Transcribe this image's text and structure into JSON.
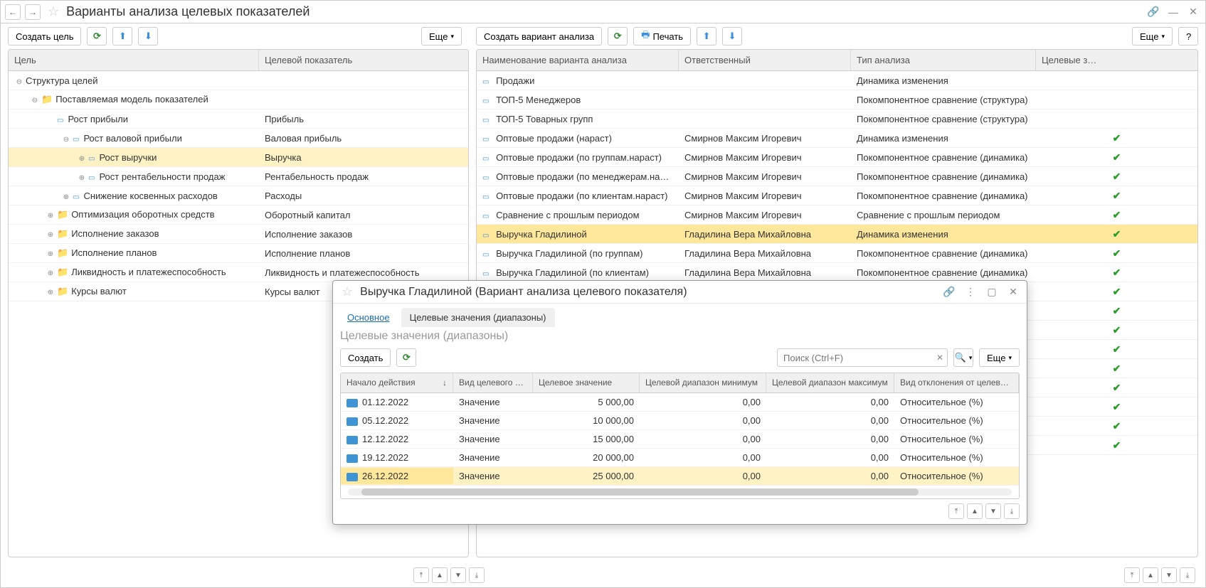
{
  "title": "Варианты анализа целевых показателей",
  "leftToolbar": {
    "createGoal": "Создать цель",
    "more": "Еще"
  },
  "rightToolbar": {
    "createVariant": "Создать вариант анализа",
    "print": "Печать",
    "more": "Еще",
    "help": "?"
  },
  "leftHeaders": {
    "goal": "Цель",
    "indicator": "Целевой показатель"
  },
  "tree": [
    {
      "level": 0,
      "exp": "-",
      "icon": "",
      "label": "Структура целей",
      "indicator": ""
    },
    {
      "level": 1,
      "exp": "-",
      "icon": "folder",
      "label": "Поставляемая модель показателей",
      "indicator": ""
    },
    {
      "level": 2,
      "exp": "",
      "icon": "node",
      "label": "Рост прибыли",
      "indicator": "Прибыль"
    },
    {
      "level": 3,
      "exp": "-",
      "icon": "node",
      "label": "Рост валовой прибыли",
      "indicator": "Валовая прибыль"
    },
    {
      "level": 4,
      "exp": "+",
      "icon": "node",
      "label": "Рост выручки",
      "indicator": "Выручка",
      "sel": true
    },
    {
      "level": 4,
      "exp": "+",
      "icon": "node",
      "label": "Рост рентабельности продаж",
      "indicator": "Рентабельность продаж"
    },
    {
      "level": 3,
      "exp": "+",
      "icon": "node",
      "label": "Снижение косвенных расходов",
      "indicator": "Расходы"
    },
    {
      "level": 2,
      "exp": "+",
      "icon": "folder",
      "label": "Оптимизация оборотных средств",
      "indicator": "Оборотный капитал"
    },
    {
      "level": 2,
      "exp": "+",
      "icon": "folder",
      "label": "Исполнение заказов",
      "indicator": "Исполнение заказов"
    },
    {
      "level": 2,
      "exp": "+",
      "icon": "folder",
      "label": "Исполнение планов",
      "indicator": "Исполнение планов"
    },
    {
      "level": 2,
      "exp": "+",
      "icon": "folder",
      "label": "Ликвидность и платежеспособность",
      "indicator": "Ликвидность и платежеспособность"
    },
    {
      "level": 2,
      "exp": "+",
      "icon": "folder",
      "label": "Курсы валют",
      "indicator": "Курсы валют"
    }
  ],
  "rightHeaders": {
    "name": "Наименование варианта анализа",
    "resp": "Ответственный",
    "type": "Тип анализа",
    "targets": "Целевые з…"
  },
  "variants": [
    {
      "name": "Продажи",
      "resp": "",
      "type": "Динамика изменения",
      "check": false
    },
    {
      "name": "ТОП-5 Менеджеров",
      "resp": "",
      "type": "Покомпонентное сравнение (структура)",
      "check": false
    },
    {
      "name": "ТОП-5 Товарных групп",
      "resp": "",
      "type": "Покомпонентное сравнение (структура)",
      "check": false
    },
    {
      "name": "Оптовые продажи (нараст)",
      "resp": "Смирнов Максим Игоревич",
      "type": "Динамика изменения",
      "check": true
    },
    {
      "name": "Оптовые продажи (по группам.нараст)",
      "resp": "Смирнов Максим Игоревич",
      "type": "Покомпонентное сравнение (динамика)",
      "check": true
    },
    {
      "name": "Оптовые продажи (по менеджерам.нараст)",
      "resp": "Смирнов Максим Игоревич",
      "type": "Покомпонентное сравнение (динамика)",
      "check": true
    },
    {
      "name": "Оптовые продажи (по клиентам.нараст)",
      "resp": "Смирнов Максим Игоревич",
      "type": "Покомпонентное сравнение (динамика)",
      "check": true
    },
    {
      "name": "Сравнение с прошлым периодом",
      "resp": "Смирнов Максим Игоревич",
      "type": "Сравнение с прошлым периодом",
      "check": true
    },
    {
      "name": "Выручка Гладилиной",
      "resp": "Гладилина Вера Михайловна",
      "type": "Динамика изменения",
      "check": true,
      "sel": true
    },
    {
      "name": "Выручка Гладилиной (по группам)",
      "resp": "Гладилина Вера Михайловна",
      "type": "Покомпонентное сравнение (динамика)",
      "check": true
    },
    {
      "name": "Выручка Гладилиной (по клиентам)",
      "resp": "Гладилина Вера Михайловна",
      "type": "Покомпонентное сравнение (динамика)",
      "check": true
    },
    {
      "name": "",
      "resp": "",
      "type": "",
      "check": true
    },
    {
      "name": "",
      "resp": "",
      "type": "",
      "check": true
    },
    {
      "name": "",
      "resp": "",
      "type": "",
      "check": true
    },
    {
      "name": "",
      "resp": "",
      "type": "",
      "check": true
    },
    {
      "name": "",
      "resp": "",
      "type": "",
      "check": true
    },
    {
      "name": "",
      "resp": "",
      "type": "",
      "check": true
    },
    {
      "name": "",
      "resp": "",
      "type": "",
      "check": true
    },
    {
      "name": "",
      "resp": "",
      "type": "",
      "check": true
    },
    {
      "name": "",
      "resp": "",
      "type": "",
      "check": true
    }
  ],
  "popup": {
    "title": "Выручка Гладилиной (Вариант анализа целевого показателя)",
    "tabs": {
      "main": "Основное",
      "targets": "Целевые значения (диапазоны)"
    },
    "subtitle": "Целевые значения (диапазоны)",
    "create": "Создать",
    "searchPlaceholder": "Поиск (Ctrl+F)",
    "more": "Еще",
    "headers": {
      "start": "Начало действия",
      "kind": "Вид целевого з…",
      "value": "Целевое значение",
      "min": "Целевой диапазон минимум",
      "max": "Целевой диапазон максимум",
      "dev": "Вид отклонения от целевог…"
    },
    "rows": [
      {
        "start": "01.12.2022",
        "kind": "Значение",
        "value": "5 000,00",
        "min": "0,00",
        "max": "0,00",
        "dev": "Относительное (%)"
      },
      {
        "start": "05.12.2022",
        "kind": "Значение",
        "value": "10 000,00",
        "min": "0,00",
        "max": "0,00",
        "dev": "Относительное (%)"
      },
      {
        "start": "12.12.2022",
        "kind": "Значение",
        "value": "15 000,00",
        "min": "0,00",
        "max": "0,00",
        "dev": "Относительное (%)"
      },
      {
        "start": "19.12.2022",
        "kind": "Значение",
        "value": "20 000,00",
        "min": "0,00",
        "max": "0,00",
        "dev": "Относительное (%)"
      },
      {
        "start": "26.12.2022",
        "kind": "Значение",
        "value": "25 000,00",
        "min": "0,00",
        "max": "0,00",
        "dev": "Относительное (%)",
        "sel": true
      }
    ]
  }
}
